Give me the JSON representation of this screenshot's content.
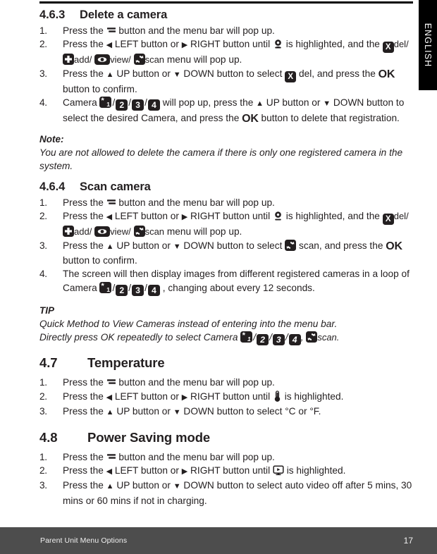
{
  "language_tab": {
    "label": "ENGLISH"
  },
  "footer": {
    "left_label": "Parent Unit Menu Options",
    "page_number": "17"
  },
  "icons": {
    "menu": "menu-bar-icon",
    "left_arrow": "◀",
    "right_arrow": "▶",
    "up_arrow": "▲",
    "down_arrow": "▼",
    "camera": "camera-icon",
    "thermometer": "thermometer-icon",
    "monitor": "power-saving-monitor-icon",
    "del": "x-delete-icon",
    "add": "plus-add-icon",
    "view": "eye-view-icon",
    "scan": "refresh-scan-icon"
  },
  "menu_labels": {
    "del": "del/",
    "add": "add/",
    "view": "view/",
    "scan": "scan",
    "scan_plain": "scan",
    "scan_period": "scan.",
    "ok": "OK"
  },
  "camera_badges": {
    "one_star": "*",
    "one": "1",
    "two": "2",
    "three": "3",
    "four": "4",
    "separator": "/"
  },
  "sections": [
    {
      "number": "4.6.3",
      "title": "Delete a camera",
      "steps": [
        {
          "marker": "1.",
          "parts": [
            "Press the ",
            "[menu]",
            " button and the menu bar will pop up."
          ]
        },
        {
          "marker": "2.",
          "text_a": "Press the ",
          "text_b": " LEFT button or ",
          "text_c": " RIGHT button until ",
          "text_d": " is highlighted, and the ",
          "text_e": " menu will pop up."
        },
        {
          "marker": "3.",
          "text_a": "Press the ",
          "text_b": " UP button or ",
          "text_c": " DOWN button to select ",
          "text_d": " del, and press the ",
          "text_e": " button to confirm."
        },
        {
          "marker": "4.",
          "text_a": "Camera ",
          "text_b": " will pop up, press the ",
          "text_c": " UP button or ",
          "text_d": " DOWN button to select the desired Camera, and press the ",
          "text_e": " button to delete that registration."
        }
      ],
      "note": {
        "title": "Note:",
        "text": "You are not allowed to delete the camera if there is only one registered camera in the system."
      }
    },
    {
      "number": "4.6.4",
      "title": "Scan camera",
      "steps": [
        {
          "marker": "1.",
          "text_a": "Press the ",
          "text_b": " button and the menu bar will pop up."
        },
        {
          "marker": "2.",
          "text_a": "Press the ",
          "text_b": " LEFT button or ",
          "text_c": " RIGHT button until ",
          "text_d": " is highlighted, and the ",
          "text_e": " menu will pop up."
        },
        {
          "marker": "3.",
          "text_a": "Press the ",
          "text_b": " UP button or ",
          "text_c": " DOWN button to select ",
          "text_d": " scan, and press the ",
          "text_e": " button to confirm."
        },
        {
          "marker": "4.",
          "text_a": "The screen will then display images from different registered cameras in a loop of Camera ",
          "text_b": " , changing about every 12 seconds."
        }
      ],
      "tip": {
        "title": "TIP",
        "line1": "Quick Method to View Cameras instead of entering into the menu bar.",
        "line2_a": "Directly press OK repeatedly to select Camera ",
        "line2_b": ",  "
      }
    },
    {
      "number": "4.7",
      "title": "Temperature",
      "steps": [
        {
          "marker": "1.",
          "text_a": "Press the ",
          "text_b": " button and the menu bar will pop up."
        },
        {
          "marker": "2.",
          "text_a": "Press the ",
          "text_b": " LEFT button or ",
          "text_c": " RIGHT button until ",
          "text_d": " is highlighted."
        },
        {
          "marker": "3.",
          "text_a": "Press the ",
          "text_b": " UP button or ",
          "text_c": " DOWN button to select °C or °F."
        }
      ]
    },
    {
      "number": "4.8",
      "title": "Power Saving mode",
      "steps": [
        {
          "marker": "1.",
          "text_a": "Press the ",
          "text_b": " button and the menu bar will pop up."
        },
        {
          "marker": "2.",
          "text_a": "Press the ",
          "text_b": " LEFT button or ",
          "text_c": " RIGHT button until ",
          "text_d": " is highlighted."
        },
        {
          "marker": "3.",
          "text_a": "Press the ",
          "text_b": " UP button or ",
          "text_c": " DOWN button to select auto video off after 5 mins, 30 mins or 60 mins if not in charging."
        }
      ]
    }
  ]
}
